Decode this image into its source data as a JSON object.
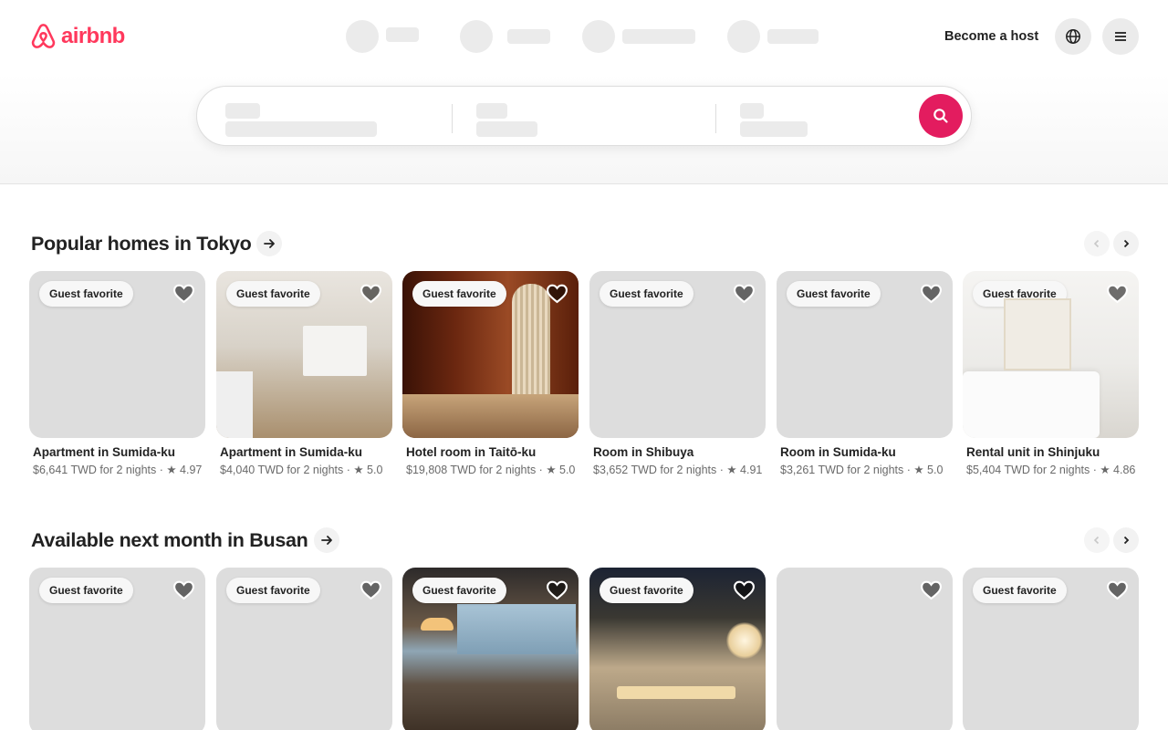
{
  "brand": {
    "name": "airbnb",
    "color": "#ff385c"
  },
  "header": {
    "become_host": "Become a host",
    "language_icon": "globe-icon",
    "menu_icon": "hamburger-menu-icon"
  },
  "search": {
    "button_icon": "search-icon",
    "button_color": "#e31c5f"
  },
  "sections": [
    {
      "title": "Popular homes in Tokyo",
      "listings": [
        {
          "badge": "Guest favorite",
          "title": "Apartment in Sumida-ku",
          "info": "$6,641 TWD for 2 nights · ★ 4.97"
        },
        {
          "badge": "Guest favorite",
          "title": "Apartment in Sumida-ku",
          "info": "$4,040 TWD for 2 nights · ★ 5.0"
        },
        {
          "badge": "Guest favorite",
          "title": "Hotel room in Taitō-ku",
          "info": "$19,808 TWD for 2 nights · ★ 5.0"
        },
        {
          "badge": "Guest favorite",
          "title": "Room in Shibuya",
          "info": "$3,652 TWD for 2 nights · ★ 4.91"
        },
        {
          "badge": "Guest favorite",
          "title": "Room in Sumida-ku",
          "info": "$3,261 TWD for 2 nights · ★ 5.0"
        },
        {
          "badge": "Guest favorite",
          "title": "Rental unit in Shinjuku",
          "info": "$5,404 TWD for 2 nights · ★ 4.86"
        }
      ]
    },
    {
      "title": "Available next month in Busan",
      "listings": [
        {
          "badge": "Guest favorite"
        },
        {
          "badge": "Guest favorite"
        },
        {
          "badge": "Guest favorite"
        },
        {
          "badge": "Guest favorite"
        },
        {
          "badge": ""
        },
        {
          "badge": "Guest favorite"
        }
      ]
    }
  ]
}
